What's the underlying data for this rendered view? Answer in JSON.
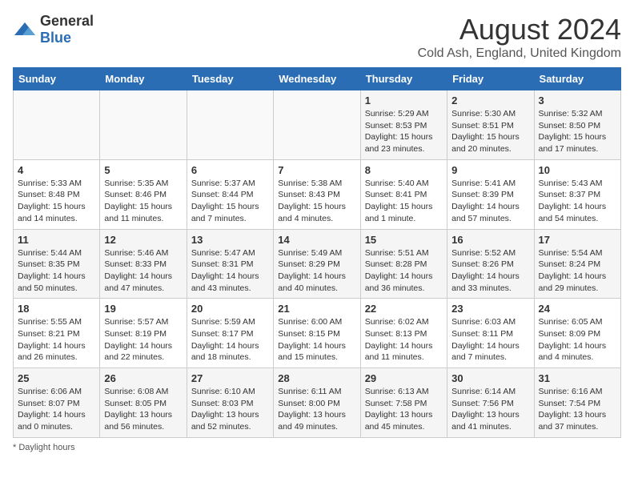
{
  "logo": {
    "text_general": "General",
    "text_blue": "Blue"
  },
  "header": {
    "title": "August 2024",
    "subtitle": "Cold Ash, England, United Kingdom"
  },
  "days_of_week": [
    "Sunday",
    "Monday",
    "Tuesday",
    "Wednesday",
    "Thursday",
    "Friday",
    "Saturday"
  ],
  "footer": {
    "note": "Daylight hours"
  },
  "weeks": [
    [
      {
        "day": "",
        "info": ""
      },
      {
        "day": "",
        "info": ""
      },
      {
        "day": "",
        "info": ""
      },
      {
        "day": "",
        "info": ""
      },
      {
        "day": "1",
        "info": "Sunrise: 5:29 AM\nSunset: 8:53 PM\nDaylight: 15 hours\nand 23 minutes."
      },
      {
        "day": "2",
        "info": "Sunrise: 5:30 AM\nSunset: 8:51 PM\nDaylight: 15 hours\nand 20 minutes."
      },
      {
        "day": "3",
        "info": "Sunrise: 5:32 AM\nSunset: 8:50 PM\nDaylight: 15 hours\nand 17 minutes."
      }
    ],
    [
      {
        "day": "4",
        "info": "Sunrise: 5:33 AM\nSunset: 8:48 PM\nDaylight: 15 hours\nand 14 minutes."
      },
      {
        "day": "5",
        "info": "Sunrise: 5:35 AM\nSunset: 8:46 PM\nDaylight: 15 hours\nand 11 minutes."
      },
      {
        "day": "6",
        "info": "Sunrise: 5:37 AM\nSunset: 8:44 PM\nDaylight: 15 hours\nand 7 minutes."
      },
      {
        "day": "7",
        "info": "Sunrise: 5:38 AM\nSunset: 8:43 PM\nDaylight: 15 hours\nand 4 minutes."
      },
      {
        "day": "8",
        "info": "Sunrise: 5:40 AM\nSunset: 8:41 PM\nDaylight: 15 hours\nand 1 minute."
      },
      {
        "day": "9",
        "info": "Sunrise: 5:41 AM\nSunset: 8:39 PM\nDaylight: 14 hours\nand 57 minutes."
      },
      {
        "day": "10",
        "info": "Sunrise: 5:43 AM\nSunset: 8:37 PM\nDaylight: 14 hours\nand 54 minutes."
      }
    ],
    [
      {
        "day": "11",
        "info": "Sunrise: 5:44 AM\nSunset: 8:35 PM\nDaylight: 14 hours\nand 50 minutes."
      },
      {
        "day": "12",
        "info": "Sunrise: 5:46 AM\nSunset: 8:33 PM\nDaylight: 14 hours\nand 47 minutes."
      },
      {
        "day": "13",
        "info": "Sunrise: 5:47 AM\nSunset: 8:31 PM\nDaylight: 14 hours\nand 43 minutes."
      },
      {
        "day": "14",
        "info": "Sunrise: 5:49 AM\nSunset: 8:29 PM\nDaylight: 14 hours\nand 40 minutes."
      },
      {
        "day": "15",
        "info": "Sunrise: 5:51 AM\nSunset: 8:28 PM\nDaylight: 14 hours\nand 36 minutes."
      },
      {
        "day": "16",
        "info": "Sunrise: 5:52 AM\nSunset: 8:26 PM\nDaylight: 14 hours\nand 33 minutes."
      },
      {
        "day": "17",
        "info": "Sunrise: 5:54 AM\nSunset: 8:24 PM\nDaylight: 14 hours\nand 29 minutes."
      }
    ],
    [
      {
        "day": "18",
        "info": "Sunrise: 5:55 AM\nSunset: 8:21 PM\nDaylight: 14 hours\nand 26 minutes."
      },
      {
        "day": "19",
        "info": "Sunrise: 5:57 AM\nSunset: 8:19 PM\nDaylight: 14 hours\nand 22 minutes."
      },
      {
        "day": "20",
        "info": "Sunrise: 5:59 AM\nSunset: 8:17 PM\nDaylight: 14 hours\nand 18 minutes."
      },
      {
        "day": "21",
        "info": "Sunrise: 6:00 AM\nSunset: 8:15 PM\nDaylight: 14 hours\nand 15 minutes."
      },
      {
        "day": "22",
        "info": "Sunrise: 6:02 AM\nSunset: 8:13 PM\nDaylight: 14 hours\nand 11 minutes."
      },
      {
        "day": "23",
        "info": "Sunrise: 6:03 AM\nSunset: 8:11 PM\nDaylight: 14 hours\nand 7 minutes."
      },
      {
        "day": "24",
        "info": "Sunrise: 6:05 AM\nSunset: 8:09 PM\nDaylight: 14 hours\nand 4 minutes."
      }
    ],
    [
      {
        "day": "25",
        "info": "Sunrise: 6:06 AM\nSunset: 8:07 PM\nDaylight: 14 hours\nand 0 minutes."
      },
      {
        "day": "26",
        "info": "Sunrise: 6:08 AM\nSunset: 8:05 PM\nDaylight: 13 hours\nand 56 minutes."
      },
      {
        "day": "27",
        "info": "Sunrise: 6:10 AM\nSunset: 8:03 PM\nDaylight: 13 hours\nand 52 minutes."
      },
      {
        "day": "28",
        "info": "Sunrise: 6:11 AM\nSunset: 8:00 PM\nDaylight: 13 hours\nand 49 minutes."
      },
      {
        "day": "29",
        "info": "Sunrise: 6:13 AM\nSunset: 7:58 PM\nDaylight: 13 hours\nand 45 minutes."
      },
      {
        "day": "30",
        "info": "Sunrise: 6:14 AM\nSunset: 7:56 PM\nDaylight: 13 hours\nand 41 minutes."
      },
      {
        "day": "31",
        "info": "Sunrise: 6:16 AM\nSunset: 7:54 PM\nDaylight: 13 hours\nand 37 minutes."
      }
    ]
  ]
}
